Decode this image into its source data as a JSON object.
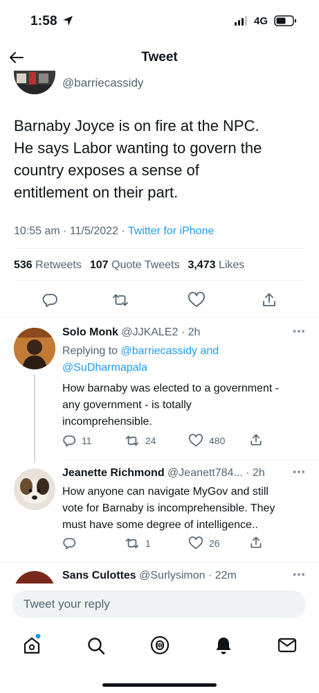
{
  "status_bar": {
    "time": "1:58",
    "network": "4G"
  },
  "header": {
    "title": "Tweet"
  },
  "main_tweet": {
    "handle": "@barriecassidy",
    "lines": [
      "Barnaby Joyce is on fire at the NPC.",
      "He says Labor wanting to govern the",
      "country exposes a sense of",
      "entitlement on their part."
    ],
    "time_date": "10:55 am · 11/5/2022 ·",
    "client": "Twitter for iPhone",
    "stats": {
      "retweets_count": "536",
      "retweets_label": "Retweets",
      "quotes_count": "107",
      "quotes_label": "Quote Tweets",
      "likes_count": "3,473",
      "likes_label": "Likes"
    },
    "icons": [
      "reply-icon",
      "retweet-icon",
      "like-icon",
      "share-icon"
    ]
  },
  "replies": [
    {
      "name": "Solo Monk",
      "handle": "@JJKALE2 · 2h",
      "replying_prefix": "Replying to",
      "replying_to_1": "@barriecassidy and",
      "replying_to_2": "@SuDharmapala",
      "lines": [
        "How barnaby was elected to a government -",
        "any government - is totally",
        "incomprehensible."
      ],
      "reply_count": "11",
      "retweet_count": "24",
      "like_count": "480"
    },
    {
      "name": "Jeanette Richmond",
      "handle": "@Jeanett784... · 2h",
      "lines": [
        "How anyone can navigate MyGov and still",
        "vote for Barnaby is incomprehensible. They",
        "must have some degree of intelligence.."
      ],
      "reply_count": "",
      "retweet_count": "1",
      "like_count": "26"
    },
    {
      "name": "Sans Culottes",
      "handle": "@Surlysimon · 22m"
    }
  ],
  "reply_box": {
    "placeholder": "Tweet your reply"
  },
  "tab_bar": [
    "home-icon",
    "search-icon",
    "spaces-icon",
    "notifications-icon",
    "messages-icon"
  ],
  "colors": {
    "accent": "#1d9bf0",
    "text": "#0f1419",
    "secondary": "#536471"
  }
}
